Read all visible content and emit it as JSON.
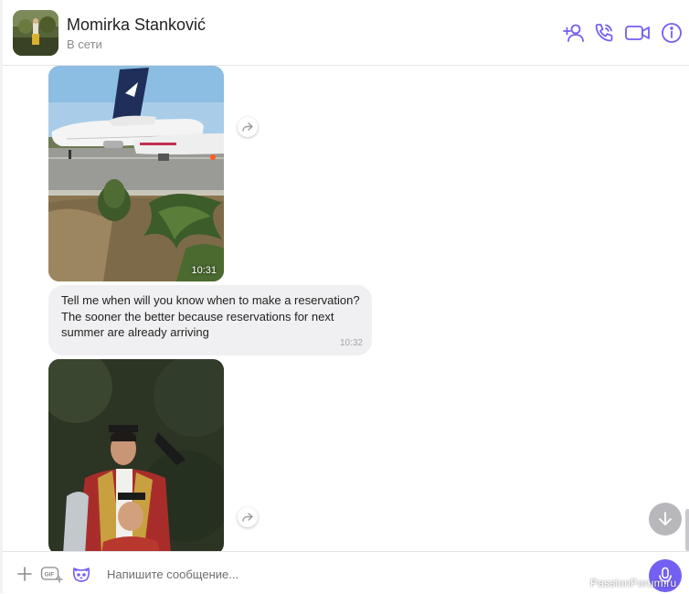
{
  "header": {
    "contact_name": "Momirka Stanković",
    "status": "В сети",
    "icons": [
      "add-contact-icon",
      "phone-icon",
      "video-icon",
      "info-icon"
    ],
    "accent": "#7360f2"
  },
  "messages": [
    {
      "type": "photo",
      "time": "10:31",
      "description_icon": "airport-photo"
    },
    {
      "type": "text",
      "text": "Tell me when will you know when to make a reservation? The sooner the better because reservations for next summer are already arriving",
      "time": "10:32"
    },
    {
      "type": "photo",
      "description_icon": "folk-costume-photo"
    }
  ],
  "composer": {
    "placeholder": "Напишите сообщение...",
    "icons": [
      "plus-icon",
      "gif-icon",
      "sticker-icon",
      "mic-icon"
    ]
  },
  "watermark": "PassionForum.ru"
}
